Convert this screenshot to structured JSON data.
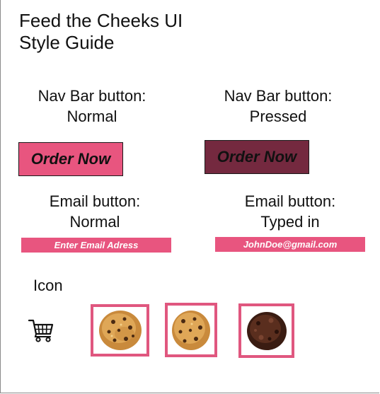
{
  "page": {
    "title_line1": "Feed the Cheeks UI",
    "title_line2": "Style Guide"
  },
  "nav_bar": {
    "normal": {
      "label_line1": "Nav Bar button:",
      "label_line2": "Normal",
      "button_text": "Order Now"
    },
    "pressed": {
      "label_line1": "Nav Bar button:",
      "label_line2": "Pressed",
      "button_text": "Order Now"
    }
  },
  "email": {
    "normal": {
      "label_line1": "Email button:",
      "label_line2": "Normal",
      "placeholder": "Enter Email Adress",
      "value": ""
    },
    "typed": {
      "label_line1": "Email button:",
      "label_line2": "Typed in",
      "placeholder": "",
      "value": "JohnDoe@gmail.com"
    }
  },
  "icons": {
    "section_label": "Icon",
    "cart_icon": "shopping-cart-icon",
    "thumbnails": [
      "cookie-icon",
      "cookie-icon",
      "chocolate-cookie-icon"
    ]
  },
  "colors": {
    "accent_pink": "#e8557f",
    "pressed_maroon": "#74293f",
    "thumb_border": "#e0577f"
  }
}
